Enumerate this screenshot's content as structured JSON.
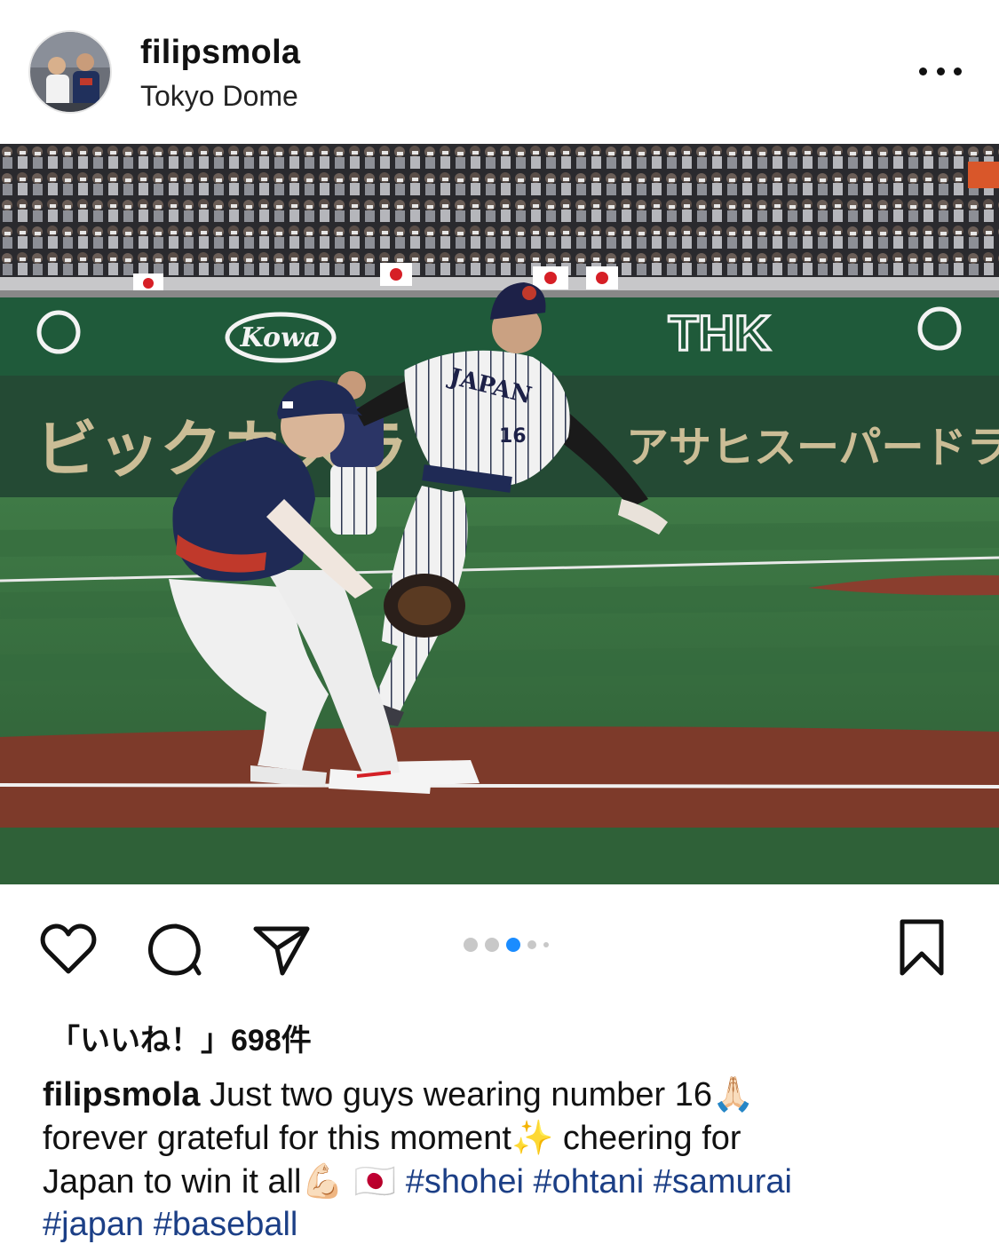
{
  "post": {
    "username": "filipsmola",
    "location": "Tokyo Dome",
    "likes_text": "「いいね！」698件",
    "caption": {
      "username": "filipsmola",
      "line1": "Just two guys wearing number 16",
      "line1_emoji": "🙏🏻",
      "line2a": "forever grateful for this moment",
      "line2_emoji": "✨",
      "line2b": "cheering for",
      "line3a": "Japan to win it all",
      "line3_emoji": "💪🏻 🇯🇵",
      "hashtags": [
        "#shohei",
        "#ohtani",
        "#samurai",
        "#japan",
        "#baseball"
      ]
    },
    "carousel": {
      "total": 5,
      "active_index": 2,
      "active_color": "#1a8cff"
    }
  },
  "photo": {
    "banner_brands": [
      "Kowa",
      "THK"
    ],
    "board_text_left": "ビックカメラ",
    "board_text_right": "アサヒスーパードライ",
    "runner_jersey": "JAPAN",
    "runner_number": "16"
  },
  "icons": {
    "more": "more-options-icon",
    "like": "heart-icon",
    "comment": "comment-bubble-icon",
    "share": "paper-plane-icon",
    "save": "bookmark-icon"
  }
}
